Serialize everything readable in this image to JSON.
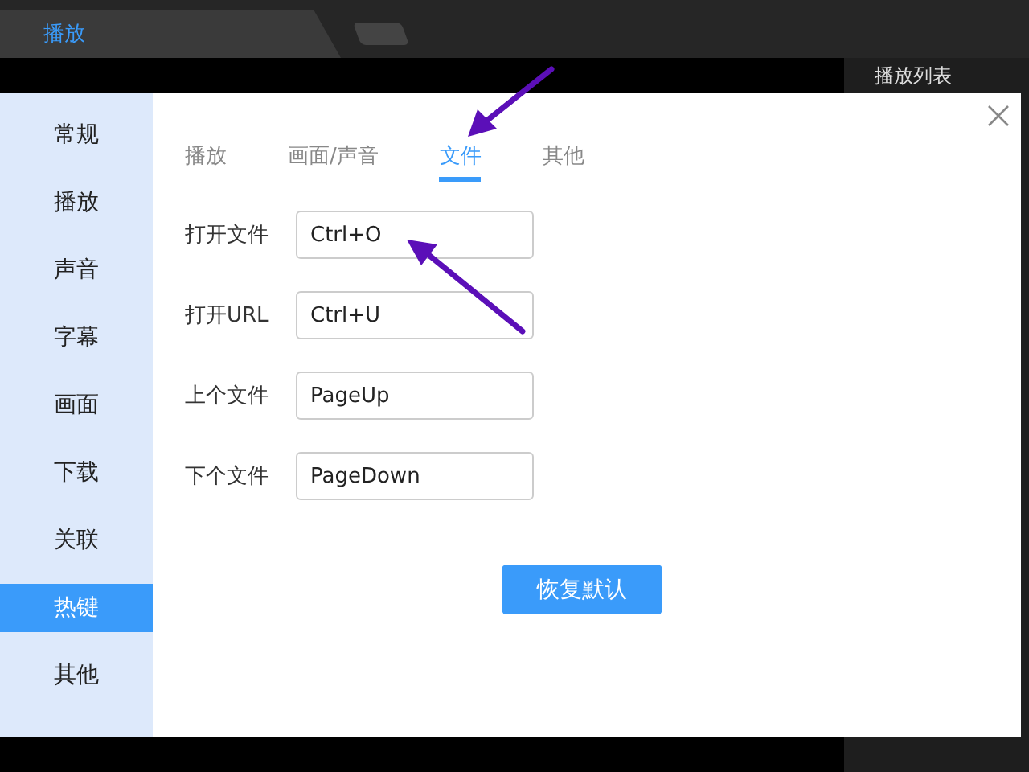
{
  "window": {
    "tab": "播放",
    "side_panel_title": "播放列表"
  },
  "sidebar": {
    "items": [
      {
        "label": "常规",
        "selected": false
      },
      {
        "label": "播放",
        "selected": false
      },
      {
        "label": "声音",
        "selected": false
      },
      {
        "label": "字幕",
        "selected": false
      },
      {
        "label": "画面",
        "selected": false
      },
      {
        "label": "下载",
        "selected": false
      },
      {
        "label": "关联",
        "selected": false
      },
      {
        "label": "热键",
        "selected": true
      },
      {
        "label": "其他",
        "selected": false
      }
    ]
  },
  "tabs": [
    {
      "label": "播放",
      "selected": false
    },
    {
      "label": "画面/声音",
      "selected": false
    },
    {
      "label": "文件",
      "selected": true
    },
    {
      "label": "其他",
      "selected": false
    }
  ],
  "hotkeys": [
    {
      "label": "打开文件",
      "value": "Ctrl+O"
    },
    {
      "label": "打开URL",
      "value": "Ctrl+U"
    },
    {
      "label": "上个文件",
      "value": "PageUp"
    },
    {
      "label": "下个文件",
      "value": "PageDown"
    }
  ],
  "buttons": [
    "恢复默认"
  ]
}
